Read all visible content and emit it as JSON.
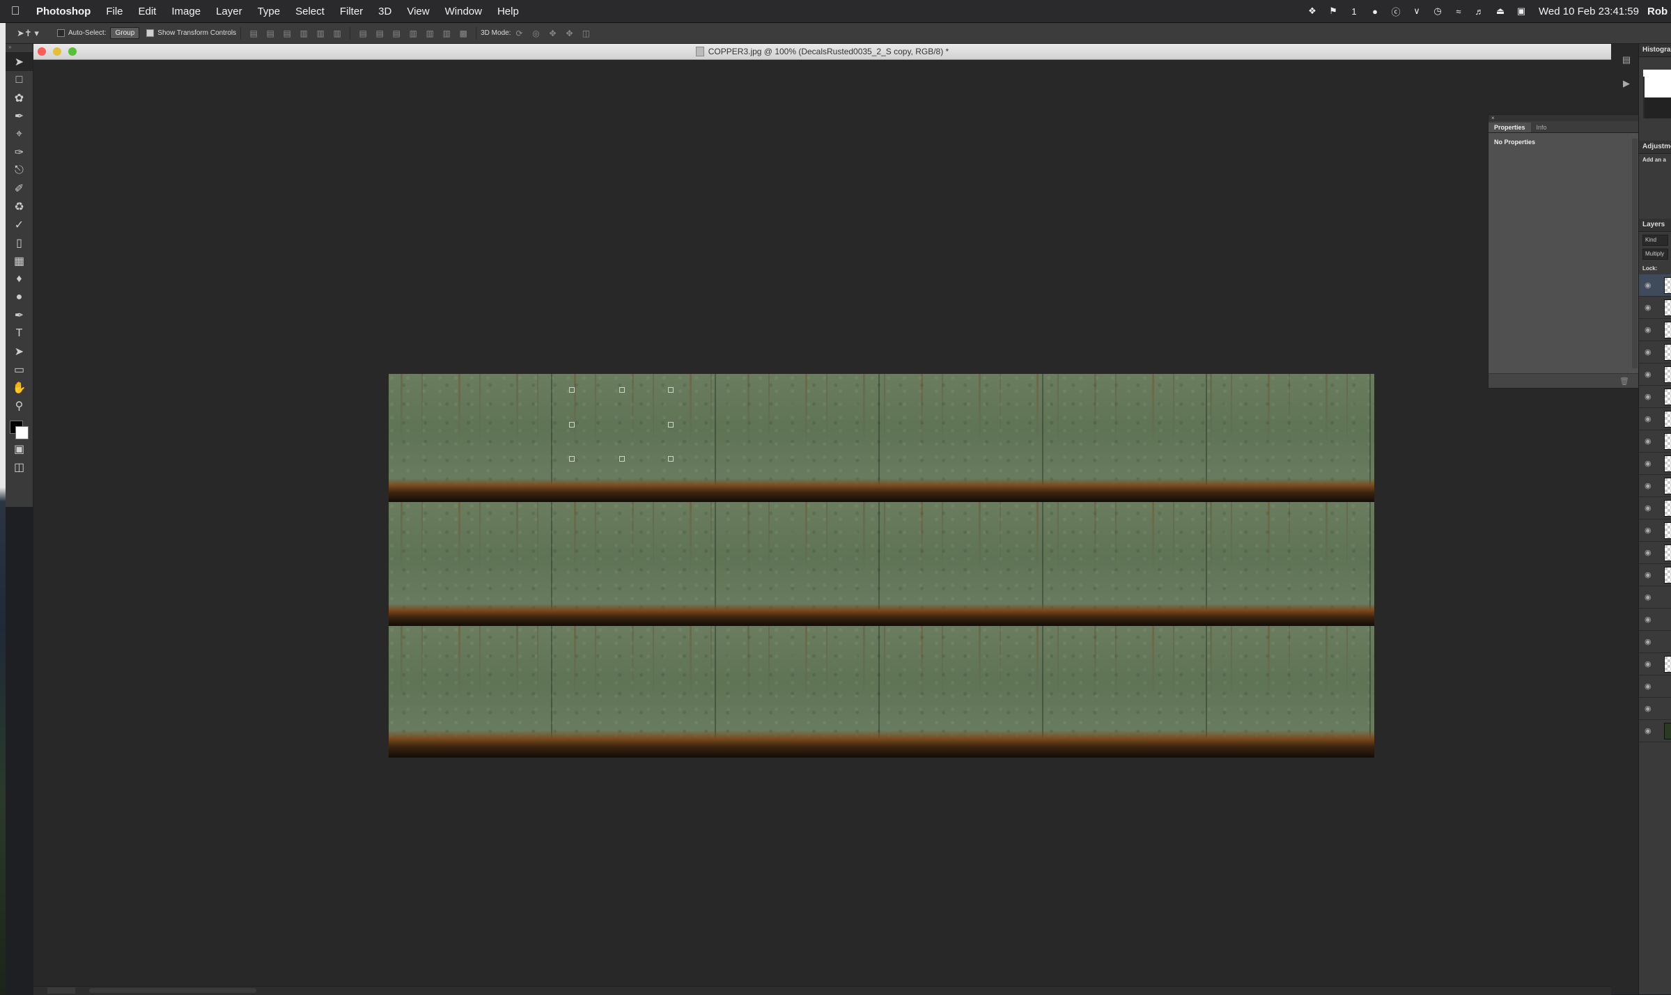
{
  "menubar": {
    "apple_icon": "apple-icon",
    "app_name": "Photoshop",
    "menus": [
      "File",
      "Edit",
      "Image",
      "Layer",
      "Type",
      "Select",
      "Filter",
      "3D",
      "View",
      "Window",
      "Help"
    ],
    "status_icons": [
      "dropbox-icon",
      "notification-icon",
      "mail-icon",
      "c-icon",
      "bluetooth-icon",
      "time-machine-icon",
      "wifi-icon",
      "volume-icon",
      "eject-icon",
      "display-icon"
    ],
    "badge_count": "1",
    "clock": "Wed 10 Feb  23:41:59",
    "user": "Rob"
  },
  "options": {
    "auto_select_label": "Auto-Select:",
    "auto_select_value": "Group",
    "show_transform_label": "Show Transform Controls",
    "mode_label": "3D Mode:"
  },
  "document": {
    "title": "COPPER3.jpg @ 100% (DecalsRusted0035_2_S copy, RGB/8) *"
  },
  "properties_panel": {
    "tabs": [
      "Properties",
      "Info"
    ],
    "active_tab": "Properties",
    "message": "No Properties"
  },
  "right_panels": {
    "histogram_title": "Histogra",
    "adjustments_title": "Adjustme",
    "adjustments_hint": "Add an a",
    "layers_title": "Layers",
    "filter_kind": "Kind",
    "blend_mode": "Multiply",
    "lock_label": "Lock:",
    "layer_count": 21
  },
  "colors": {
    "accent": "#57c038",
    "close": "#fc5b57",
    "minimize": "#e5bf3c",
    "rust": "#7a4a1e",
    "copper_green": "#5d7052"
  }
}
